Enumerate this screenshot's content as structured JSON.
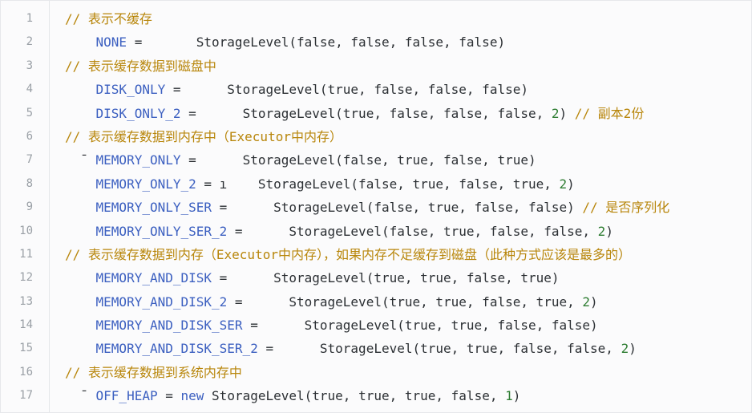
{
  "code_lines": [
    {
      "num": "1",
      "parts": [
        {
          "t": "// 表示不缓存",
          "c": "cm"
        }
      ]
    },
    {
      "num": "2",
      "parts": [
        {
          "t": "    "
        },
        {
          "t": "NONE",
          "c": "cst"
        },
        {
          "t": " =       "
        },
        {
          "t": "StorageLevel",
          "c": "fn"
        },
        {
          "t": "(false, false, false, false)"
        }
      ]
    },
    {
      "num": "3",
      "parts": [
        {
          "t": "// 表示缓存数据到磁盘中",
          "c": "cm"
        }
      ]
    },
    {
      "num": "4",
      "parts": [
        {
          "t": "    "
        },
        {
          "t": "DISK_ONLY",
          "c": "cst"
        },
        {
          "t": " =      "
        },
        {
          "t": "StorageLevel",
          "c": "fn"
        },
        {
          "t": "(true, false, false, false)"
        }
      ]
    },
    {
      "num": "5",
      "parts": [
        {
          "t": "    "
        },
        {
          "t": "DISK_ONLY_2",
          "c": "cst"
        },
        {
          "t": " =      "
        },
        {
          "t": "StorageLevel",
          "c": "fn"
        },
        {
          "t": "(true, false, false, false, "
        },
        {
          "t": "2",
          "c": "num"
        },
        {
          "t": ") "
        },
        {
          "t": "// 副本2份",
          "c": "cm"
        }
      ]
    },
    {
      "num": "6",
      "parts": [
        {
          "t": "// 表示缓存数据到内存中（Executor中内存）",
          "c": "cm"
        }
      ]
    },
    {
      "num": "7",
      "parts": [
        {
          "t": "  ˉ ",
          "c": "mark"
        },
        {
          "t": "MEMORY_ONLY",
          "c": "cst"
        },
        {
          "t": " =      "
        },
        {
          "t": "StorageLevel",
          "c": "fn"
        },
        {
          "t": "(false, true, false, true)"
        }
      ]
    },
    {
      "num": "8",
      "parts": [
        {
          "t": "    "
        },
        {
          "t": "MEMORY_ONLY_2",
          "c": "cst"
        },
        {
          "t": " = ı    "
        },
        {
          "t": "StorageLevel",
          "c": "fn"
        },
        {
          "t": "(false, true, false, true, "
        },
        {
          "t": "2",
          "c": "num"
        },
        {
          "t": ")"
        }
      ]
    },
    {
      "num": "9",
      "parts": [
        {
          "t": "    "
        },
        {
          "t": "MEMORY_ONLY_SER",
          "c": "cst"
        },
        {
          "t": " =      "
        },
        {
          "t": "StorageLevel",
          "c": "fn"
        },
        {
          "t": "(false, true, false, false) "
        },
        {
          "t": "// 是否序列化",
          "c": "cm"
        }
      ]
    },
    {
      "num": "10",
      "parts": [
        {
          "t": "    "
        },
        {
          "t": "MEMORY_ONLY_SER_2",
          "c": "cst"
        },
        {
          "t": " =      "
        },
        {
          "t": "StorageLevel",
          "c": "fn"
        },
        {
          "t": "(false, true, false, false, "
        },
        {
          "t": "2",
          "c": "num"
        },
        {
          "t": ")"
        }
      ]
    },
    {
      "num": "11",
      "parts": [
        {
          "t": "// 表示缓存数据到内存（Executor中内存），如果内存不足缓存到磁盘（此种方式应该是最多的）",
          "c": "cm"
        }
      ]
    },
    {
      "num": "12",
      "parts": [
        {
          "t": "    "
        },
        {
          "t": "MEMORY_AND_DISK",
          "c": "cst"
        },
        {
          "t": " =      "
        },
        {
          "t": "StorageLevel",
          "c": "fn"
        },
        {
          "t": "(true, true, false, true)"
        }
      ]
    },
    {
      "num": "13",
      "parts": [
        {
          "t": "    "
        },
        {
          "t": "MEMORY_AND_DISK_2",
          "c": "cst"
        },
        {
          "t": " =      "
        },
        {
          "t": "StorageLevel",
          "c": "fn"
        },
        {
          "t": "(true, true, false, true, "
        },
        {
          "t": "2",
          "c": "num"
        },
        {
          "t": ")"
        }
      ]
    },
    {
      "num": "14",
      "parts": [
        {
          "t": "    "
        },
        {
          "t": "MEMORY_AND_DISK_SER",
          "c": "cst"
        },
        {
          "t": " =      "
        },
        {
          "t": "StorageLevel",
          "c": "fn"
        },
        {
          "t": "(true, true, false, false)"
        }
      ]
    },
    {
      "num": "15",
      "parts": [
        {
          "t": "    "
        },
        {
          "t": "MEMORY_AND_DISK_SER_2",
          "c": "cst"
        },
        {
          "t": " =      "
        },
        {
          "t": "StorageLevel",
          "c": "fn"
        },
        {
          "t": "(true, true, false, false, "
        },
        {
          "t": "2",
          "c": "num"
        },
        {
          "t": ")"
        }
      ]
    },
    {
      "num": "16",
      "parts": [
        {
          "t": "// 表示缓存数据到系统内存中",
          "c": "cm"
        }
      ]
    },
    {
      "num": "17",
      "parts": [
        {
          "t": "  ˉ ",
          "c": "mark"
        },
        {
          "t": "OFF_HEAP",
          "c": "cst"
        },
        {
          "t": " = "
        },
        {
          "t": "new",
          "c": "kw"
        },
        {
          "t": " "
        },
        {
          "t": "StorageLevel",
          "c": "fn"
        },
        {
          "t": "(true, true, true, false, "
        },
        {
          "t": "1",
          "c": "num"
        },
        {
          "t": ")"
        }
      ]
    }
  ],
  "colors": {
    "comment": "#b8860b",
    "constant": "#3b5fc0",
    "number": "#2e7d32",
    "text": "#2b2f33",
    "line_number": "#9aa0a6",
    "background": "#fbfbfc"
  }
}
